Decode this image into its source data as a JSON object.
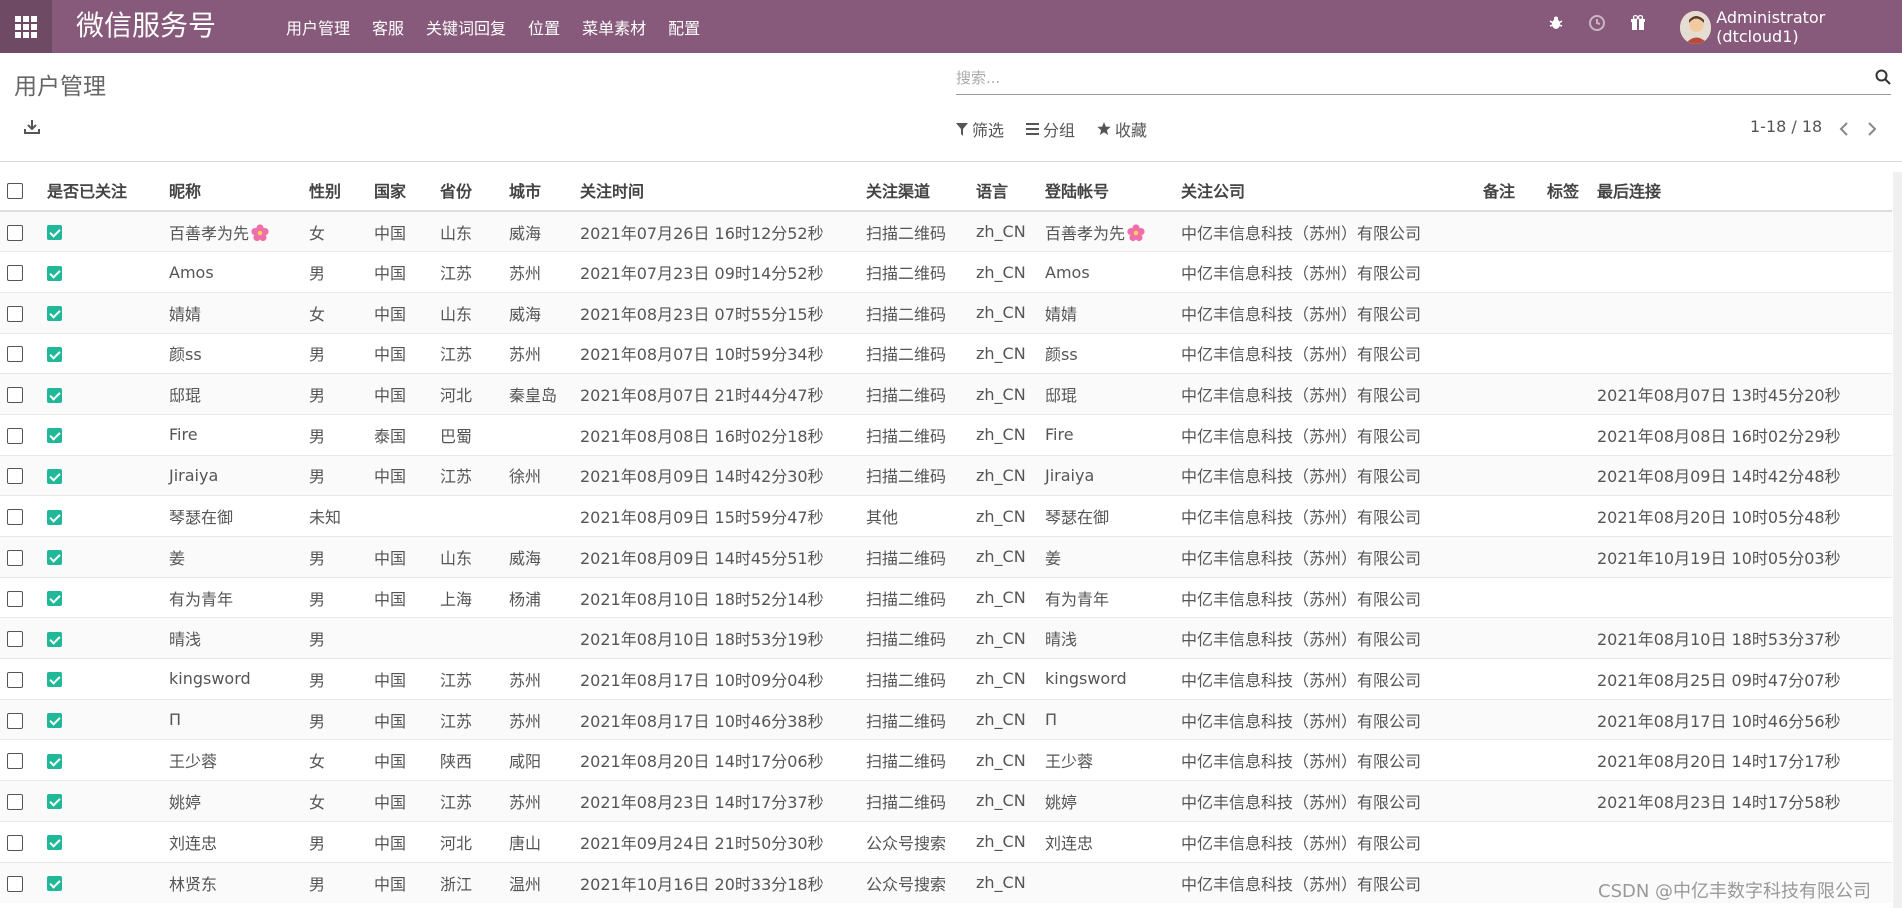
{
  "topbar": {
    "brand": "微信服务号",
    "menu": [
      "用户管理",
      "客服",
      "关键词回复",
      "位置",
      "菜单素材",
      "配置"
    ],
    "user": "Administrator (dtcloud1)"
  },
  "page": {
    "title": "用户管理",
    "search_placeholder": "搜索...",
    "filters": {
      "filter": "筛选",
      "group": "分组",
      "favorite": "收藏"
    },
    "pager": "1-18 / 18"
  },
  "table": {
    "columns": [
      "是否已关注",
      "昵称",
      "性别",
      "国家",
      "省份",
      "城市",
      "关注时间",
      "关注渠道",
      "语言",
      "登陆帐号",
      "关注公司",
      "备注",
      "标签",
      "最后连接"
    ],
    "rows": [
      {
        "nick": "百善孝为先",
        "flower": true,
        "gender": "女",
        "country": "中国",
        "province": "山东",
        "city": "威海",
        "time": "2021年07月26日 16时12分52秒",
        "channel": "扫描二维码",
        "lang": "zh_CN",
        "account": "百善孝为先",
        "company": "中亿丰信息科技（苏州）有限公司",
        "note": "",
        "tag": "",
        "last": ""
      },
      {
        "nick": "Amos",
        "gender": "男",
        "country": "中国",
        "province": "江苏",
        "city": "苏州",
        "time": "2021年07月23日 09时14分52秒",
        "channel": "扫描二维码",
        "lang": "zh_CN",
        "account": "Amos",
        "company": "中亿丰信息科技（苏州）有限公司",
        "note": "",
        "tag": "",
        "last": ""
      },
      {
        "nick": "婧婧",
        "gender": "女",
        "country": "中国",
        "province": "山东",
        "city": "威海",
        "time": "2021年08月23日 07时55分15秒",
        "channel": "扫描二维码",
        "lang": "zh_CN",
        "account": "婧婧",
        "company": "中亿丰信息科技（苏州）有限公司",
        "note": "",
        "tag": "",
        "last": ""
      },
      {
        "nick": "颜ss",
        "gender": "男",
        "country": "中国",
        "province": "江苏",
        "city": "苏州",
        "time": "2021年08月07日 10时59分34秒",
        "channel": "扫描二维码",
        "lang": "zh_CN",
        "account": "颜ss",
        "company": "中亿丰信息科技（苏州）有限公司",
        "note": "",
        "tag": "",
        "last": ""
      },
      {
        "nick": "邸琨",
        "gender": "男",
        "country": "中国",
        "province": "河北",
        "city": "秦皇岛",
        "time": "2021年08月07日 21时44分47秒",
        "channel": "扫描二维码",
        "lang": "zh_CN",
        "account": "邸琨",
        "company": "中亿丰信息科技（苏州）有限公司",
        "note": "",
        "tag": "",
        "last": "2021年08月07日 13时45分20秒"
      },
      {
        "nick": "Fire",
        "gender": "男",
        "country": "泰国",
        "province": "巴蜀",
        "city": "",
        "time": "2021年08月08日 16时02分18秒",
        "channel": "扫描二维码",
        "lang": "zh_CN",
        "account": "Fire",
        "company": "中亿丰信息科技（苏州）有限公司",
        "note": "",
        "tag": "",
        "last": "2021年08月08日 16时02分29秒"
      },
      {
        "nick": "Jiraiya",
        "gender": "男",
        "country": "中国",
        "province": "江苏",
        "city": "徐州",
        "time": "2021年08月09日 14时42分30秒",
        "channel": "扫描二维码",
        "lang": "zh_CN",
        "account": "Jiraiya",
        "company": "中亿丰信息科技（苏州）有限公司",
        "note": "",
        "tag": "",
        "last": "2021年08月09日 14时42分48秒"
      },
      {
        "nick": "琴瑟在御",
        "gender": "未知",
        "country": "",
        "province": "",
        "city": "",
        "time": "2021年08月09日 15时59分47秒",
        "channel": "其他",
        "lang": "zh_CN",
        "account": "琴瑟在御",
        "company": "中亿丰信息科技（苏州）有限公司",
        "note": "",
        "tag": "",
        "last": "2021年08月20日 10时05分48秒"
      },
      {
        "nick": "姜",
        "gender": "男",
        "country": "中国",
        "province": "山东",
        "city": "威海",
        "time": "2021年08月09日 14时45分51秒",
        "channel": "扫描二维码",
        "lang": "zh_CN",
        "account": "姜",
        "company": "中亿丰信息科技（苏州）有限公司",
        "note": "",
        "tag": "",
        "last": "2021年10月19日 10时05分03秒"
      },
      {
        "nick": "有为青年",
        "gender": "男",
        "country": "中国",
        "province": "上海",
        "city": "杨浦",
        "time": "2021年08月10日 18时52分14秒",
        "channel": "扫描二维码",
        "lang": "zh_CN",
        "account": "有为青年",
        "company": "中亿丰信息科技（苏州）有限公司",
        "note": "",
        "tag": "",
        "last": ""
      },
      {
        "nick": "晴浅",
        "gender": "男",
        "country": "",
        "province": "",
        "city": "",
        "time": "2021年08月10日 18时53分19秒",
        "channel": "扫描二维码",
        "lang": "zh_CN",
        "account": "晴浅",
        "company": "中亿丰信息科技（苏州）有限公司",
        "note": "",
        "tag": "",
        "last": "2021年08月10日 18时53分37秒"
      },
      {
        "nick": "kingsword",
        "gender": "男",
        "country": "中国",
        "province": "江苏",
        "city": "苏州",
        "time": "2021年08月17日 10时09分04秒",
        "channel": "扫描二维码",
        "lang": "zh_CN",
        "account": "kingsword",
        "company": "中亿丰信息科技（苏州）有限公司",
        "note": "",
        "tag": "",
        "last": "2021年08月25日 09时47分07秒"
      },
      {
        "nick": "Π",
        "gender": "男",
        "country": "中国",
        "province": "江苏",
        "city": "苏州",
        "time": "2021年08月17日 10时46分38秒",
        "channel": "扫描二维码",
        "lang": "zh_CN",
        "account": "Π",
        "company": "中亿丰信息科技（苏州）有限公司",
        "note": "",
        "tag": "",
        "last": "2021年08月17日 10时46分56秒"
      },
      {
        "nick": "王少蓉",
        "gender": "女",
        "country": "中国",
        "province": "陕西",
        "city": "咸阳",
        "time": "2021年08月20日 14时17分06秒",
        "channel": "扫描二维码",
        "lang": "zh_CN",
        "account": "王少蓉",
        "company": "中亿丰信息科技（苏州）有限公司",
        "note": "",
        "tag": "",
        "last": "2021年08月20日 14时17分17秒"
      },
      {
        "nick": "姚婷",
        "gender": "女",
        "country": "中国",
        "province": "江苏",
        "city": "苏州",
        "time": "2021年08月23日 14时17分37秒",
        "channel": "扫描二维码",
        "lang": "zh_CN",
        "account": "姚婷",
        "company": "中亿丰信息科技（苏州）有限公司",
        "note": "",
        "tag": "",
        "last": "2021年08月23日 14时17分58秒"
      },
      {
        "nick": "刘连忠",
        "gender": "男",
        "country": "中国",
        "province": "河北",
        "city": "唐山",
        "time": "2021年09月24日 21时50分30秒",
        "channel": "公众号搜索",
        "lang": "zh_CN",
        "account": "刘连忠",
        "company": "中亿丰信息科技（苏州）有限公司",
        "note": "",
        "tag": "",
        "last": ""
      },
      {
        "nick": "林贤东",
        "gender": "男",
        "country": "中国",
        "province": "浙江",
        "city": "温州",
        "time": "2021年10月16日 20时33分18秒",
        "channel": "公众号搜索",
        "lang": "zh_CN",
        "account": "",
        "company": "中亿丰信息科技（苏州）有限公司",
        "note": "",
        "tag": "",
        "last": ""
      }
    ]
  },
  "watermark": "CSDN @中亿丰数字科技有限公司"
}
